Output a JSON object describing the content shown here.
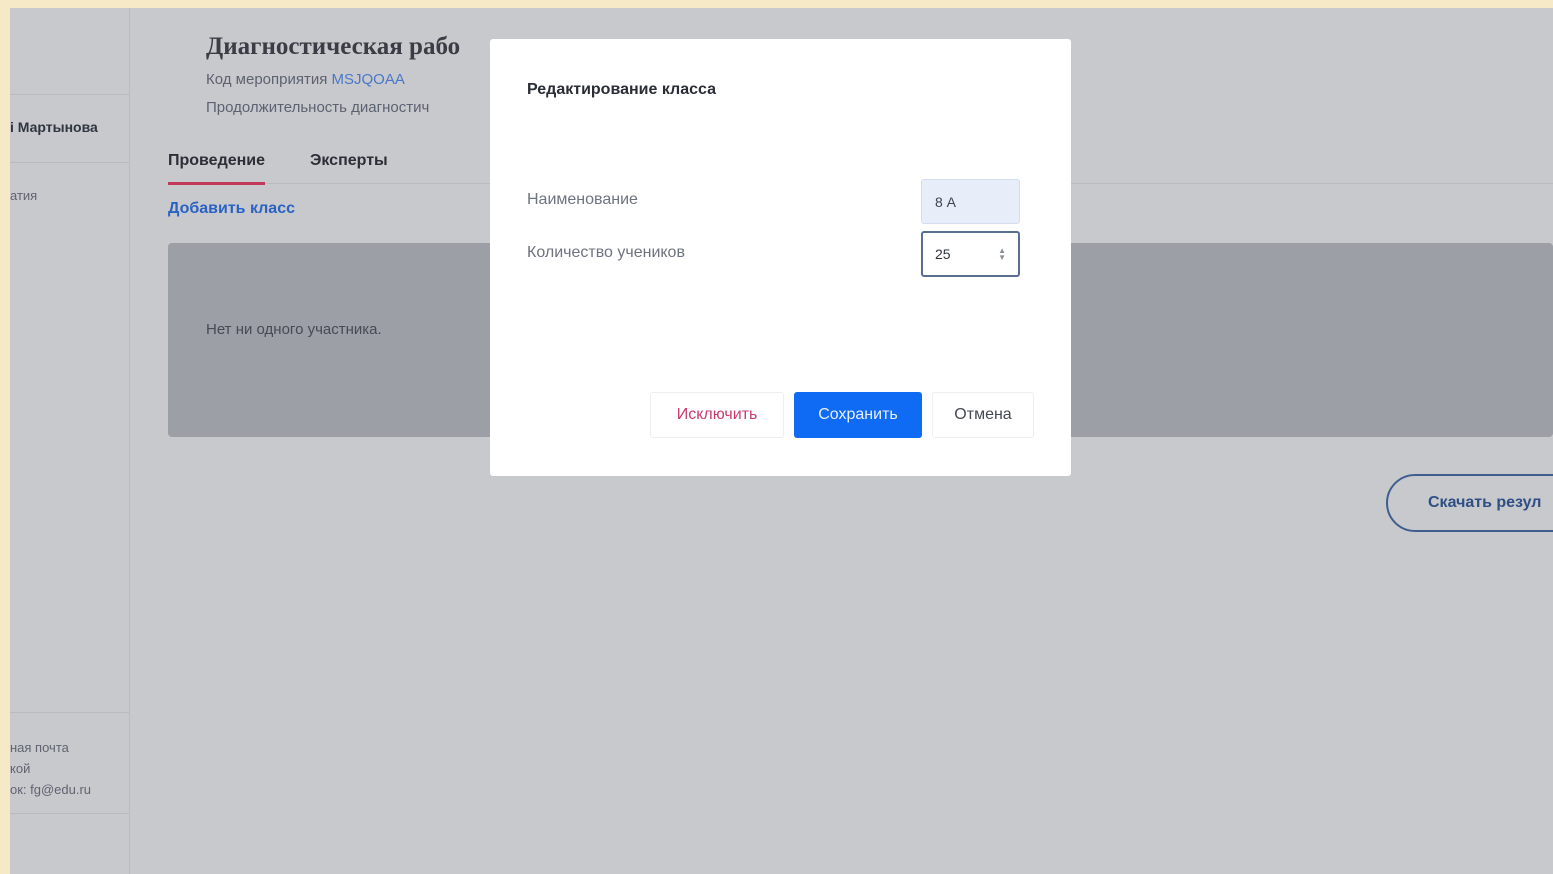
{
  "sidebar": {
    "user_name": "і Мартынова",
    "nav_item": "атия",
    "support_lines": [
      "ная почта",
      "кой",
      "ок: fg@edu.ru"
    ]
  },
  "page": {
    "title": "Диагностическая рабо",
    "code_label": "Код мероприятия ",
    "code_value": "MSJQOAA",
    "duration_label": "Продолжительность диагностич"
  },
  "tabs": [
    {
      "label": "Проведение",
      "active": true
    },
    {
      "label": "Эксперты",
      "active": false
    }
  ],
  "actions": {
    "add_class": "Добавить класс",
    "download": "Скачать резул"
  },
  "empty_state": "Нет ни одного участника.",
  "modal": {
    "title": "Редактирование класса",
    "name_label": "Наименование",
    "name_value": "8 А",
    "count_label": "Количество учеников",
    "count_value": "25",
    "buttons": {
      "exclude": "Исключить",
      "save": "Сохранить",
      "cancel": "Отмена"
    }
  },
  "colors": {
    "accent": "#0f6af4",
    "tab_underline": "#c0385a",
    "exclude_text": "#c93b6d",
    "link": "#2a62c4"
  }
}
